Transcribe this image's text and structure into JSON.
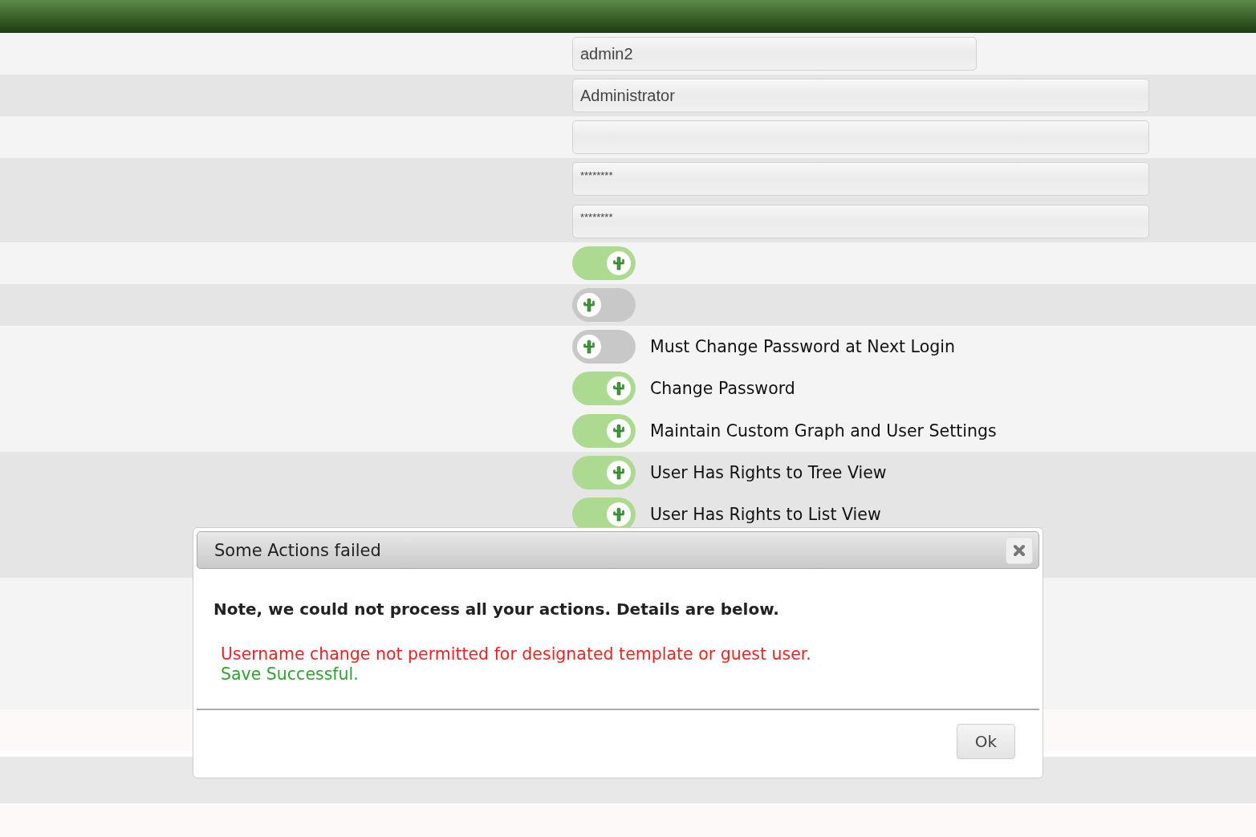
{
  "sections": [
    {
      "items": [
        {
          "kind": "text",
          "value": "admin2"
        }
      ]
    },
    {
      "items": [
        {
          "kind": "text",
          "value": "Administrator"
        }
      ]
    },
    {
      "items": [
        {
          "kind": "empty"
        }
      ]
    },
    {
      "items": [
        {
          "kind": "password",
          "value": "********"
        },
        {
          "kind": "password",
          "value": "********"
        }
      ]
    },
    {
      "items": [
        {
          "kind": "toggle",
          "on": true
        }
      ]
    },
    {
      "items": [
        {
          "kind": "toggle",
          "on": false
        }
      ]
    },
    {
      "items": [
        {
          "kind": "toggle",
          "on": false,
          "label": "Must Change Password at Next Login"
        },
        {
          "kind": "toggle",
          "on": true,
          "label": "Change Password"
        },
        {
          "kind": "toggle",
          "on": true,
          "label": "Maintain Custom Graph and User Settings"
        }
      ]
    },
    {
      "items": [
        {
          "kind": "toggle",
          "on": true,
          "label": "User Has Rights to Tree View"
        },
        {
          "kind": "toggle",
          "on": true,
          "label": "User Has Rights to List View"
        }
      ]
    }
  ],
  "dialog": {
    "title": "Some Actions failed",
    "message": "Note, we could not process all your actions. Details are below.",
    "results": [
      {
        "text": "Username change not permitted for designated template or guest user.",
        "color": "#ee2222"
      },
      {
        "text": "Save Successful.",
        "color": "#33a033"
      }
    ],
    "button": "Ok"
  }
}
